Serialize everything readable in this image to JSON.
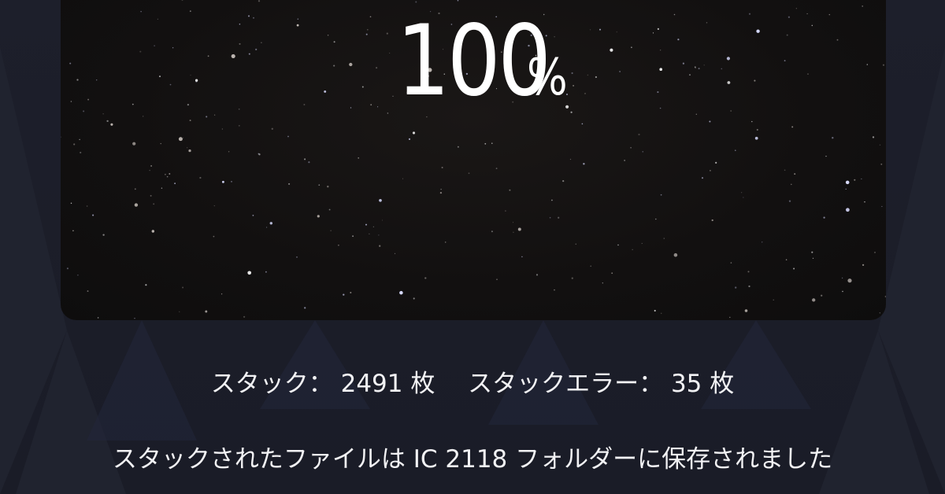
{
  "progress": {
    "value": "100",
    "unit": "%"
  },
  "stats": {
    "stack_label": "スタック：",
    "stack_count": "2491",
    "stack_unit": "枚",
    "error_label": "スタックエラー：",
    "error_count": "35",
    "error_unit": "枚"
  },
  "status": {
    "message": "スタックされたファイルは IC 2118 フォルダーに保存されました"
  }
}
